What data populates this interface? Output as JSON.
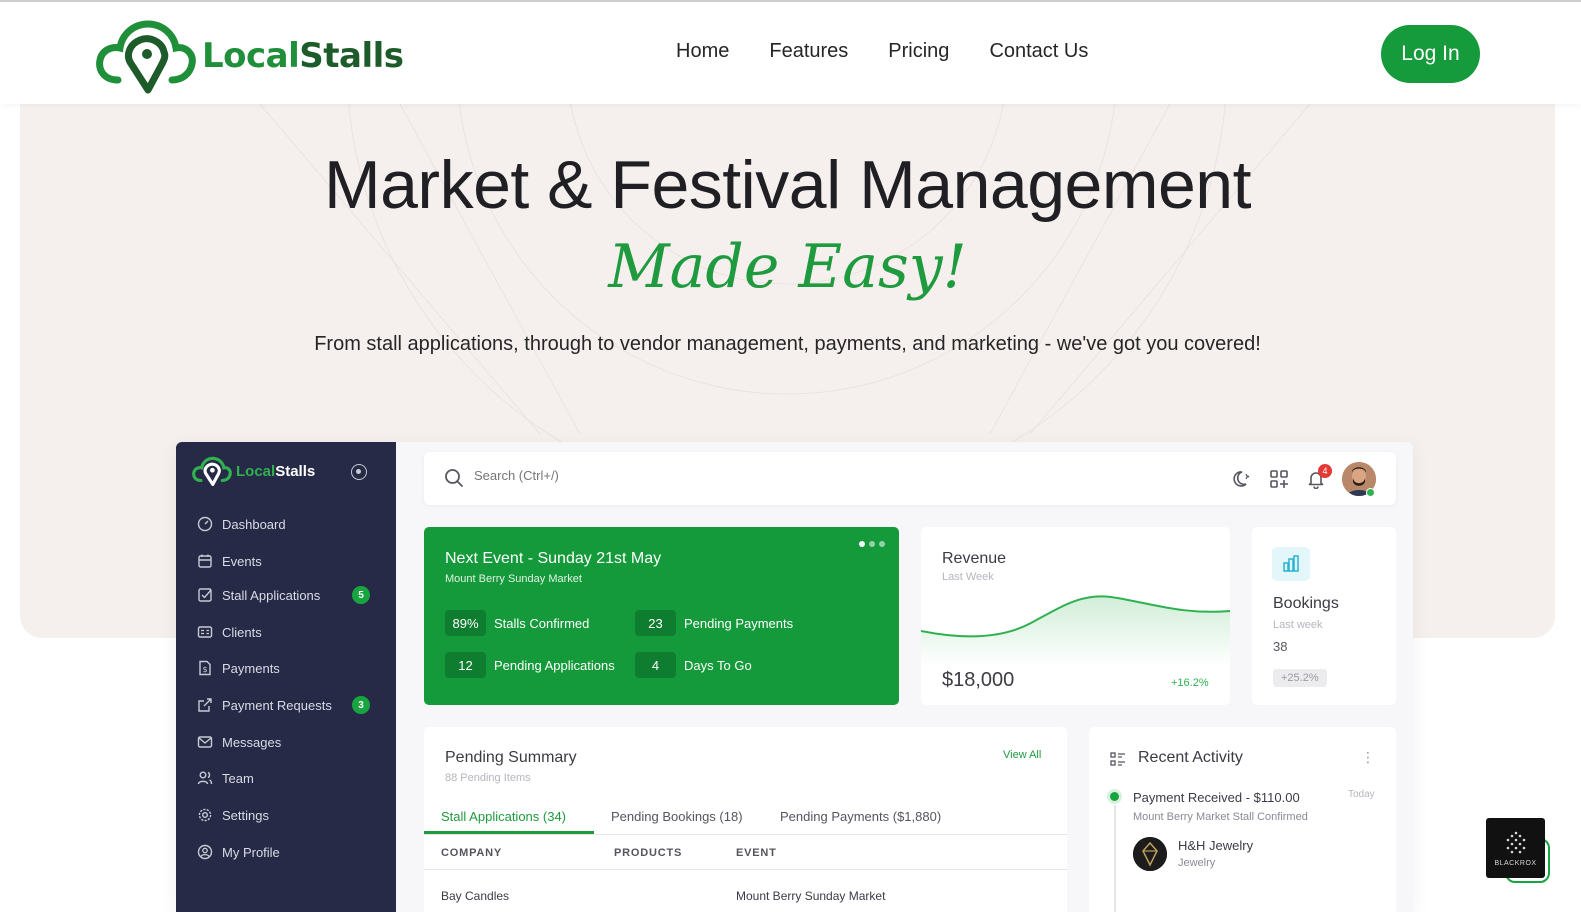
{
  "header": {
    "brand_part1": "Local",
    "brand_part2": "Stalls",
    "nav": [
      "Home",
      "Features",
      "Pricing",
      "Contact Us"
    ],
    "login_label": "Log In",
    "accent_color": "#159a3c"
  },
  "hero": {
    "title": "Market & Festival Management",
    "script": "Made Easy!",
    "subtitle": "From stall applications, through to vendor management, payments, and marketing - we've got you covered!"
  },
  "dashboard": {
    "brand_part1": "Local",
    "brand_part2": "Stalls",
    "sidebar": [
      {
        "label": "Dashboard",
        "icon": "dashboard-icon",
        "badge": ""
      },
      {
        "label": "Events",
        "icon": "calendar-icon",
        "badge": ""
      },
      {
        "label": "Stall Applications",
        "icon": "checkbox-icon",
        "badge": "5"
      },
      {
        "label": "Clients",
        "icon": "id-card-icon",
        "badge": ""
      },
      {
        "label": "Payments",
        "icon": "dollar-file-icon",
        "badge": ""
      },
      {
        "label": "Payment Requests",
        "icon": "external-link-icon",
        "badge": "3"
      },
      {
        "label": "Messages",
        "icon": "mail-icon",
        "badge": ""
      },
      {
        "label": "Team",
        "icon": "users-icon",
        "badge": ""
      },
      {
        "label": "Settings",
        "icon": "gear-icon",
        "badge": ""
      },
      {
        "label": "My Profile",
        "icon": "user-circle-icon",
        "badge": ""
      }
    ],
    "search_placeholder": "Search (Ctrl+/)",
    "notification_count": "4",
    "next_event": {
      "title": "Next Event - Sunday 21st May",
      "subtitle": "Mount Berry Sunday Market",
      "stats": [
        {
          "value": "89%",
          "label": "Stalls Confirmed"
        },
        {
          "value": "23",
          "label": "Pending Payments"
        },
        {
          "value": "12",
          "label": "Pending Applications"
        },
        {
          "value": "4",
          "label": "Days To Go"
        }
      ]
    },
    "revenue": {
      "title": "Revenue",
      "subtitle": "Last Week",
      "amount": "$18,000",
      "change": "+16.2%"
    },
    "bookings": {
      "title": "Bookings",
      "subtitle": "Last week",
      "value": "38",
      "change": "+25.2%"
    },
    "pending_summary": {
      "title": "Pending Summary",
      "subtitle": "88 Pending Items",
      "view_all": "View All",
      "tabs": [
        "Stall Applications (34)",
        "Pending Bookings (18)",
        "Pending Payments ($1,880)"
      ],
      "columns": [
        "COMPANY",
        "PRODUCTS",
        "EVENT"
      ],
      "rows": [
        {
          "company": "Bay Candles",
          "products": "",
          "event": "Mount Berry Sunday Market"
        }
      ]
    },
    "recent_activity": {
      "title": "Recent Activity",
      "item_title": "Payment Received - $110.00",
      "item_time": "Today",
      "item_sub": "Mount Berry Market   Stall Confirmed",
      "vendor_name": "H&H Jewelry",
      "vendor_sub": "Jewelry"
    }
  },
  "widget": {
    "label": "BLACKROX"
  }
}
